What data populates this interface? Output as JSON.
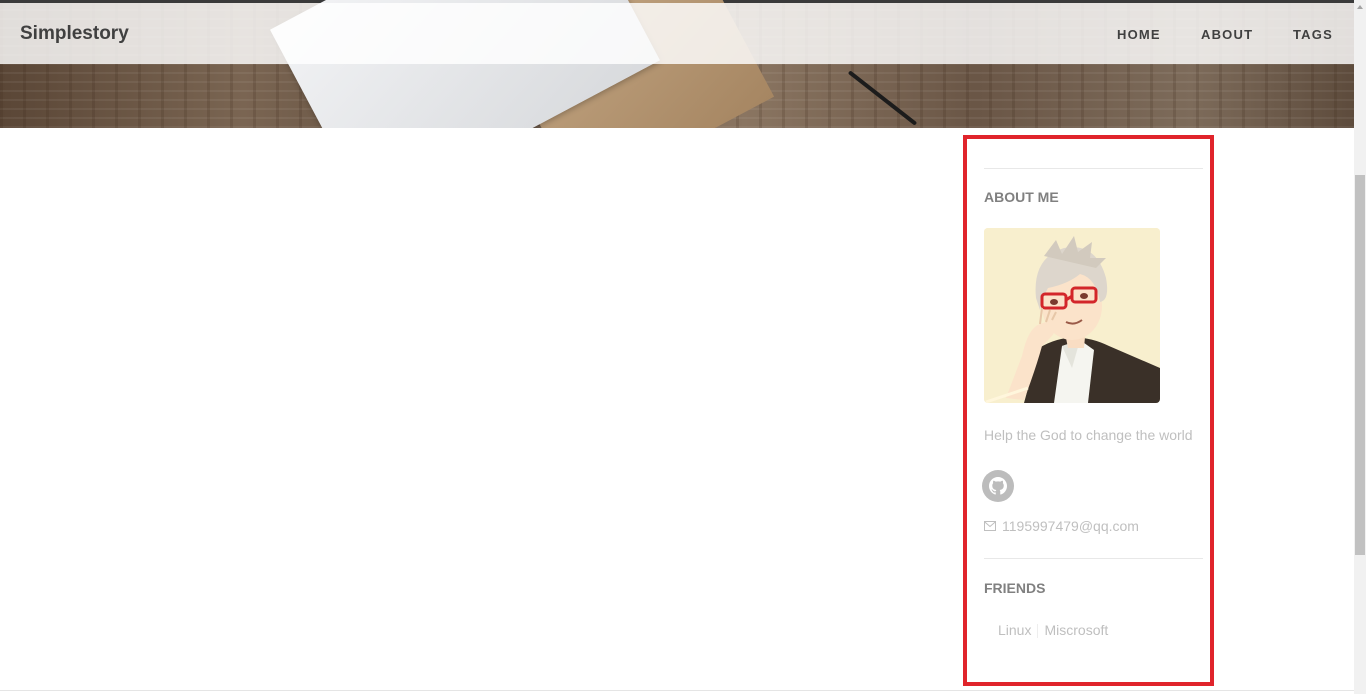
{
  "navbar": {
    "brand": "Simplestory",
    "links": [
      {
        "label": "HOME"
      },
      {
        "label": "ABOUT"
      },
      {
        "label": "TAGS"
      }
    ]
  },
  "sidebar": {
    "about_title": "ABOUT ME",
    "bio": "Help the God to change the world",
    "social": [
      {
        "icon": "github-icon"
      }
    ],
    "email": "1195997479@qq.com",
    "friends_title": "FRIENDS",
    "friends": [
      {
        "label": "Linux"
      },
      {
        "label": "Miscrosoft"
      }
    ]
  },
  "colors": {
    "highlight": "#e0242b",
    "nav_text": "#404040",
    "muted_text": "#bfbfbf",
    "heading_text": "#808080"
  }
}
